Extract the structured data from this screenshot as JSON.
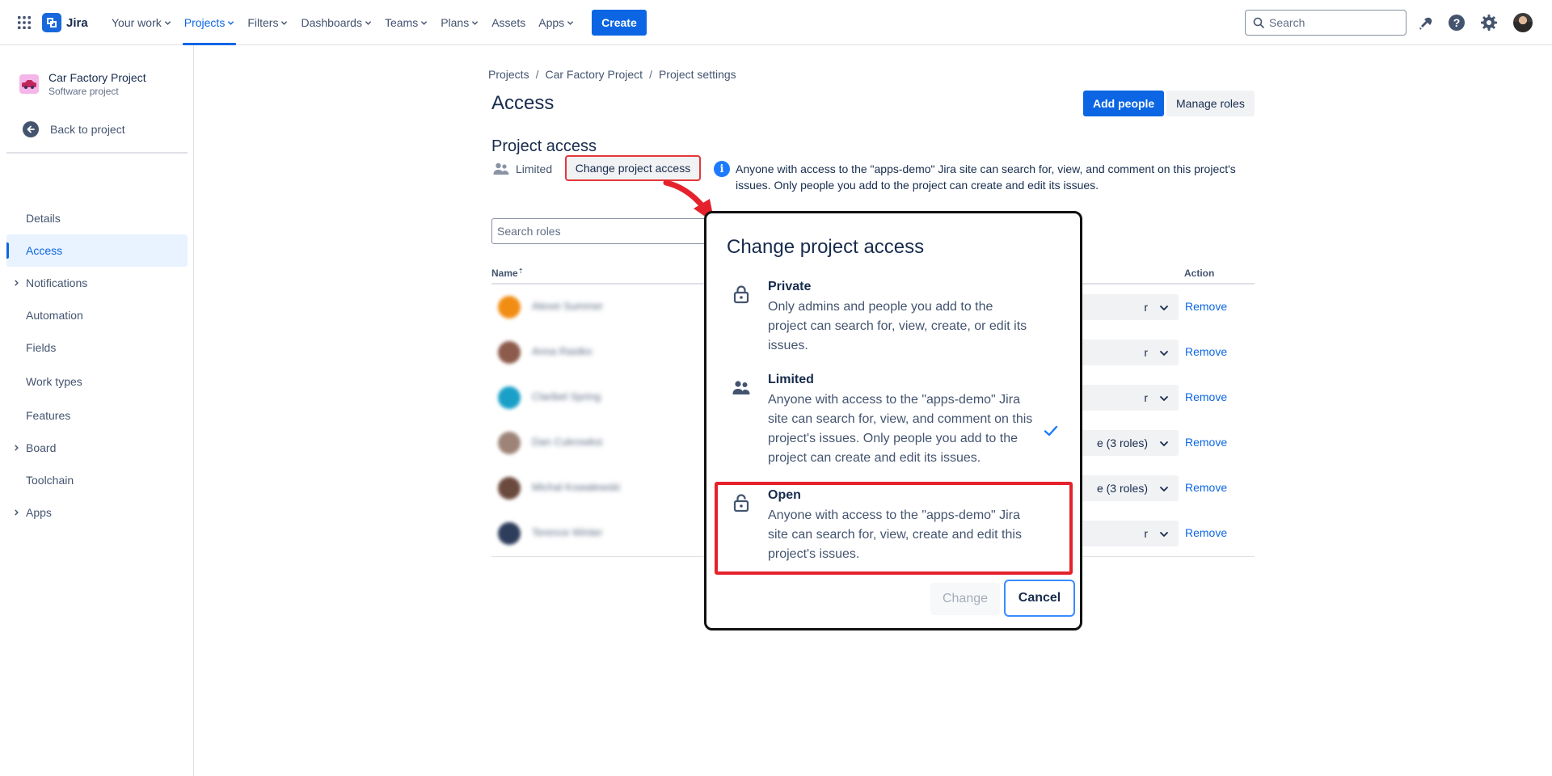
{
  "topnav": {
    "logo_text": "Jira",
    "items": [
      {
        "label": "Your work",
        "has_dropdown": true
      },
      {
        "label": "Projects",
        "has_dropdown": true,
        "active": true
      },
      {
        "label": "Filters",
        "has_dropdown": true
      },
      {
        "label": "Dashboards",
        "has_dropdown": true
      },
      {
        "label": "Teams",
        "has_dropdown": true
      },
      {
        "label": "Plans",
        "has_dropdown": true
      },
      {
        "label": "Assets",
        "has_dropdown": false
      },
      {
        "label": "Apps",
        "has_dropdown": true
      }
    ],
    "create_label": "Create",
    "search_placeholder": "Search",
    "icons": [
      "notifications-icon",
      "help-icon",
      "settings-icon",
      "profile-avatar"
    ],
    "accent_color": "#0c66e4"
  },
  "sidebar": {
    "project_name": "Car Factory Project",
    "project_type": "Software project",
    "back_label": "Back to project",
    "items": [
      {
        "label": "Details",
        "expandable": false,
        "active": false
      },
      {
        "label": "Access",
        "expandable": false,
        "active": true
      },
      {
        "label": "Notifications",
        "expandable": true,
        "active": false
      },
      {
        "label": "Automation",
        "expandable": false,
        "active": false
      },
      {
        "label": "Fields",
        "expandable": false,
        "active": false
      },
      {
        "label": "Work types",
        "expandable": false,
        "active": false
      },
      {
        "label": "Features",
        "expandable": false,
        "active": false
      },
      {
        "label": "Board",
        "expandable": true,
        "active": false
      },
      {
        "label": "Toolchain",
        "expandable": false,
        "active": false
      },
      {
        "label": "Apps",
        "expandable": true,
        "active": false
      }
    ]
  },
  "main": {
    "breadcrumb": [
      "Projects",
      "Car Factory Project",
      "Project settings"
    ],
    "title": "Access",
    "add_people_label": "Add people",
    "manage_roles_label": "Manage roles",
    "project_access_title": "Project access",
    "current_access": "Limited",
    "change_access_label": "Change project access",
    "info_text": "Anyone with access to the \"apps-demo\" Jira site can search for, view, and comment on this project's issues. Only people you add to the project can create and edit its issues.",
    "search_roles_placeholder": "Search roles",
    "table": {
      "col_name": "Name",
      "col_action": "Action",
      "rows": [
        {
          "name": "Alexei Summer",
          "role": "r",
          "action": "Remove",
          "avatar_color": "#f18d13"
        },
        {
          "name": "Anna Rastko",
          "role": "r",
          "action": "Remove",
          "avatar_color": "#8d5b4c"
        },
        {
          "name": "Claribel Spring",
          "role": "r",
          "action": "Remove",
          "avatar_color": "#1aa0c8"
        },
        {
          "name": "Dan Cukrowksi",
          "role": "e (3 roles)",
          "action": "Remove",
          "avatar_color": "#9e8478"
        },
        {
          "name": "Michal Kowalewski",
          "role": "e (3 roles)",
          "action": "Remove",
          "avatar_color": "#6b4a3e"
        },
        {
          "name": "Terence Winter",
          "role": "r",
          "action": "Remove",
          "avatar_color": "#2e3d5c"
        }
      ]
    }
  },
  "modal": {
    "title": "Change project access",
    "options": [
      {
        "label": "Private",
        "description": "Only admins and people you add to the project can search for, view, create, or edit its issues.",
        "icon": "lock-icon",
        "selected": false
      },
      {
        "label": "Limited",
        "description": "Anyone with access to the \"apps-demo\" Jira site can search for, view, and comment on this project's issues. Only people you add to the project can create and edit its issues.",
        "icon": "people-icon",
        "selected": true
      },
      {
        "label": "Open",
        "description": "Anyone with access to the \"apps-demo\" Jira site can search for, view, create and edit this project's issues.",
        "icon": "unlock-icon",
        "selected": false,
        "highlighted": true
      }
    ],
    "change_label": "Change",
    "cancel_label": "Cancel",
    "highlight_color": "#e5222c"
  }
}
